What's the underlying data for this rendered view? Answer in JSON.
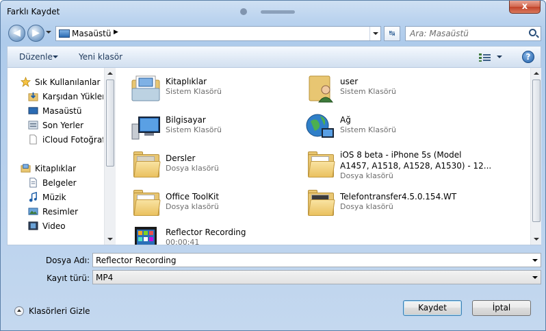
{
  "window": {
    "title": "Farklı Kaydet",
    "close_label": "x"
  },
  "nav": {
    "back_glyph": "◀",
    "forward_glyph": "▶",
    "address_text": "Masaüstü",
    "address_arrow": "▶",
    "refresh_glyph": "↹",
    "search_placeholder": "Ara: Masaüstü"
  },
  "toolbar": {
    "organize_label": "Düzenle",
    "new_folder_label": "Yeni klasör",
    "help_label": "?"
  },
  "sidebar": {
    "favorites_label": "Sık Kullanılanlar",
    "favorites": [
      {
        "label": "Karşıdan Yüklem",
        "icon": "downloads-icon"
      },
      {
        "label": "Masaüstü",
        "icon": "desktop-icon"
      },
      {
        "label": "Son Yerler",
        "icon": "recent-places-icon"
      },
      {
        "label": "iCloud Fotoğrafla",
        "icon": "icloud-photos-icon"
      }
    ],
    "libraries_label": "Kitaplıklar",
    "libraries": [
      {
        "label": "Belgeler",
        "icon": "documents-icon"
      },
      {
        "label": "Müzik",
        "icon": "music-icon"
      },
      {
        "label": "Resimler",
        "icon": "pictures-icon"
      },
      {
        "label": "Video",
        "icon": "video-icon"
      }
    ]
  },
  "files": [
    {
      "name": "Kitaplıklar",
      "type": "Sistem Klasörü",
      "icon": "libraries-icon"
    },
    {
      "name": "user",
      "type": "Sistem Klasörü",
      "icon": "user-folder-icon"
    },
    {
      "name": "Bilgisayar",
      "type": "Sistem Klasörü",
      "icon": "computer-icon"
    },
    {
      "name": "Ağ",
      "type": "Sistem Klasörü",
      "icon": "network-icon"
    },
    {
      "name": "Dersler",
      "type": "Dosya klasörü",
      "icon": "folder-icon"
    },
    {
      "name": "iOS 8 beta - iPhone 5s (Model\nA1457, A1518, A1528, A1530) - 12...",
      "type": "Dosya klasörü",
      "icon": "folder-icon"
    },
    {
      "name": "Office ToolKit",
      "type": "Dosya klasörü",
      "icon": "folder-icon"
    },
    {
      "name": "Telefontransfer4.5.0.154.WT",
      "type": "Dosya klasörü",
      "icon": "folder-icon"
    },
    {
      "name": "Reflector Recording",
      "type": "00:00:41",
      "icon": "video-file-icon"
    }
  ],
  "form": {
    "filename_label": "Dosya Adı:",
    "filename_value": "Reflector Recording",
    "filetype_label": "Kayıt türü:",
    "filetype_value": "MP4"
  },
  "footer": {
    "hide_folders_label": "Klasörleri Gizle",
    "save_label": "Kaydet",
    "cancel_label": "İptal"
  },
  "colors": {
    "accent": "#1e395b",
    "frame_border": "#b7c9df",
    "window_bg": "#c4d8ef"
  }
}
